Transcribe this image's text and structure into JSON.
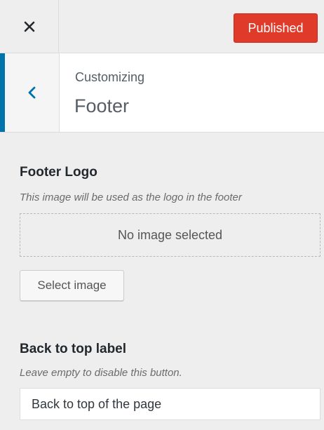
{
  "topbar": {
    "close_icon": "close-icon",
    "publish_label": "Published",
    "publish_color": "#e03a2a"
  },
  "section": {
    "back_icon": "chevron-left-icon",
    "accent_color": "#0073aa",
    "subtitle": "Customizing",
    "title": "Footer"
  },
  "footer_logo": {
    "title": "Footer Logo",
    "description": "This image will be used as the logo in the footer",
    "placeholder": "No image selected",
    "select_label": "Select image"
  },
  "back_to_top": {
    "title": "Back to top label",
    "description": "Leave empty to disable this button.",
    "value": "Back to top of the page"
  }
}
